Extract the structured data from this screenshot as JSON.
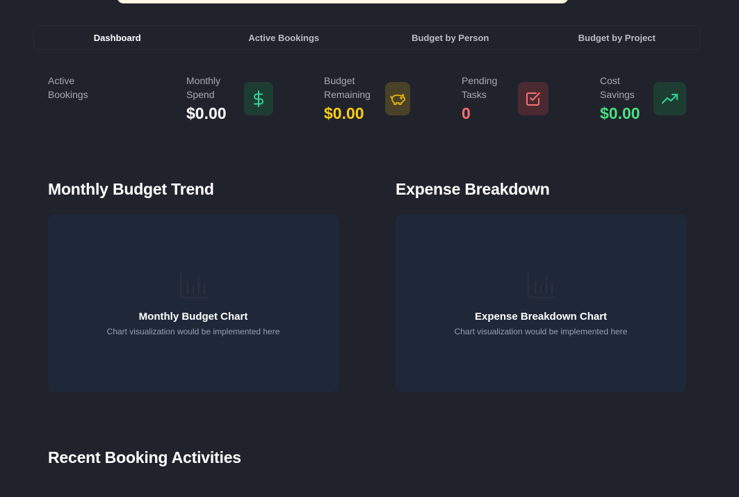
{
  "tabs": [
    {
      "label": "Dashboard",
      "active": true
    },
    {
      "label": "Active Bookings",
      "active": false
    },
    {
      "label": "Budget by Person",
      "active": false
    },
    {
      "label": "Budget by Project",
      "active": false
    }
  ],
  "stats": {
    "active_bookings": {
      "label": "Active Bookings",
      "value": ""
    },
    "monthly_spend": {
      "label": "Monthly Spend",
      "value": "$0.00",
      "color": "#ffffff",
      "icon": "dollar-icon",
      "icon_bg": "#1e3d32",
      "icon_color": "#34d399"
    },
    "budget_remaining": {
      "label": "Budget Remaining",
      "value": "$0.00",
      "color": "#facc15",
      "icon": "piggy-bank-icon",
      "icon_bg": "#4a4228",
      "icon_color": "#eab308"
    },
    "pending_tasks": {
      "label": "Pending Tasks",
      "value": "0",
      "color": "#f87171",
      "icon": "checkbox-icon",
      "icon_bg": "#4a2a30",
      "icon_color": "#f87171"
    },
    "cost_savings": {
      "label": "Cost Savings",
      "value": "$0.00",
      "color": "#4ade80",
      "icon": "trending-up-icon",
      "icon_bg": "#1e3d32",
      "icon_color": "#34d399"
    }
  },
  "sections": {
    "monthly_trend_title": "Monthly Budget Trend",
    "expense_breakdown_title": "Expense Breakdown",
    "recent_title": "Recent Booking Activities"
  },
  "charts": {
    "monthly": {
      "title": "Monthly Budget Chart",
      "subtitle": "Chart visualization would be implemented here",
      "icon": "bar-chart-icon"
    },
    "expense": {
      "title": "Expense Breakdown Chart",
      "subtitle": "Chart visualization would be implemented here",
      "icon": "bar-chart-icon"
    }
  }
}
